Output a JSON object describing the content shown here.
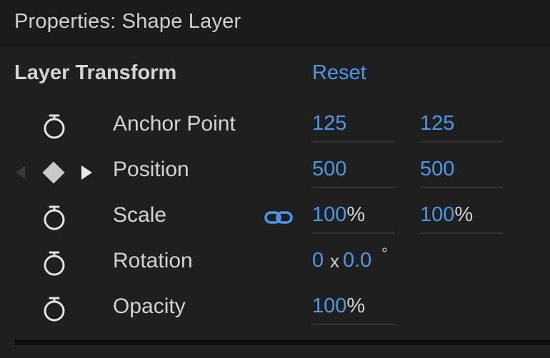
{
  "panel": {
    "title": "Properties: Shape Layer"
  },
  "section": {
    "title": "Layer Transform",
    "reset_label": "Reset"
  },
  "properties": {
    "anchor_point": {
      "label": "Anchor Point",
      "x": "125",
      "y": "125",
      "icon": "stopwatch-icon"
    },
    "position": {
      "label": "Position",
      "x": "500",
      "y": "500",
      "icons": [
        "previous-keyframe-icon",
        "keyframe-diamond-icon",
        "next-keyframe-icon"
      ]
    },
    "scale": {
      "label": "Scale",
      "x": "100",
      "x_unit": "%",
      "y": "100",
      "y_unit": "%",
      "link_icon": "link-icon",
      "icon": "stopwatch-icon"
    },
    "rotation": {
      "label": "Rotation",
      "revolutions": "0",
      "separator": "x",
      "degrees": "0.0",
      "degree_symbol": "°",
      "icon": "stopwatch-icon"
    },
    "opacity": {
      "label": "Opacity",
      "value": "100",
      "unit": "%",
      "icon": "stopwatch-icon"
    }
  },
  "colors": {
    "background": "#1f1f1f",
    "value_blue": "#4c97e8",
    "text": "#d2d2d2"
  }
}
